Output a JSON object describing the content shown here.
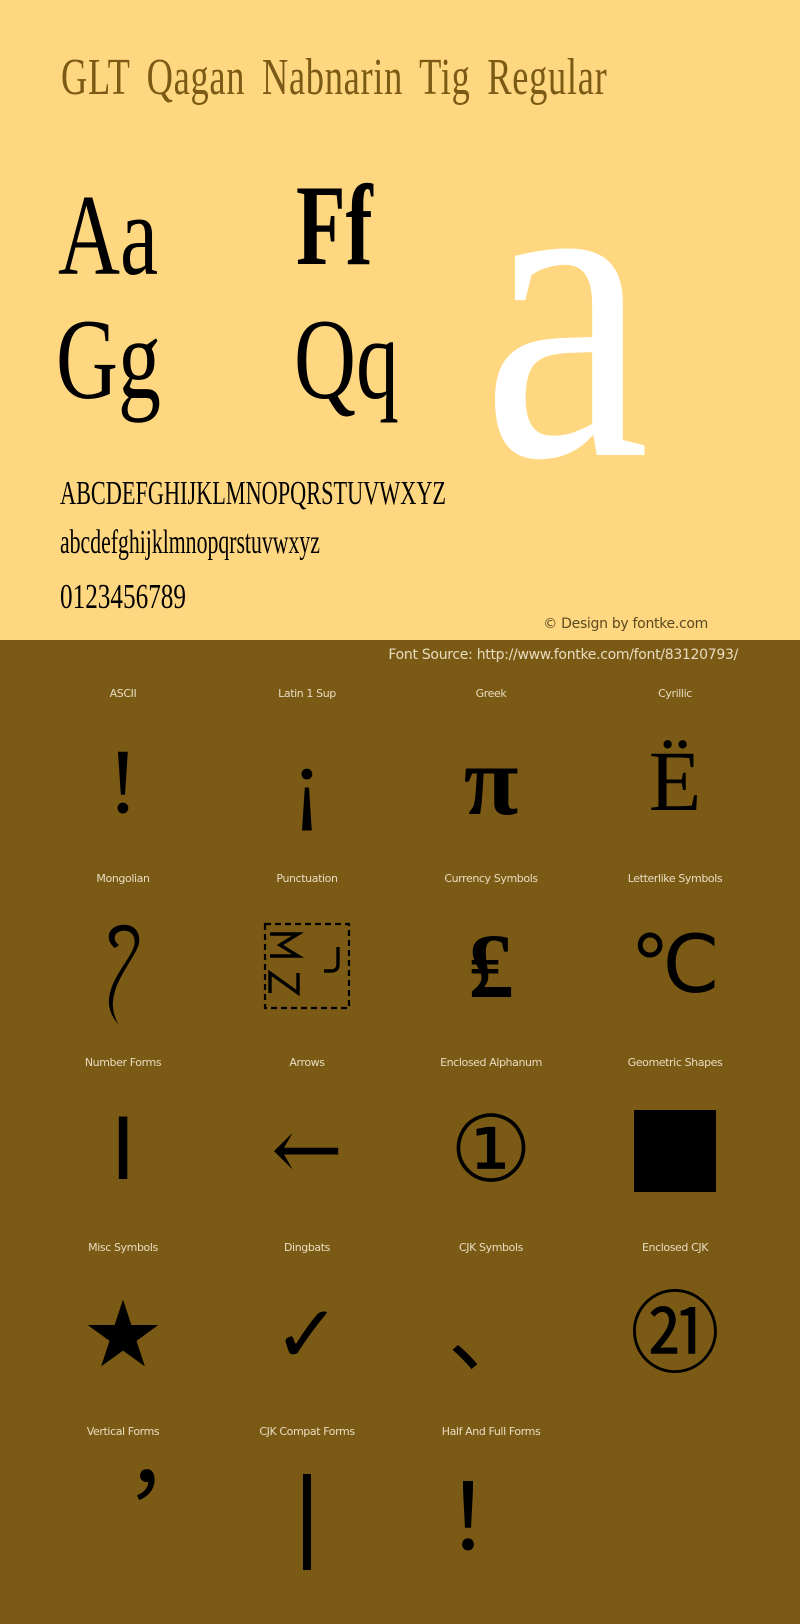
{
  "header": {
    "title": "GLT Qagan Nabnarin Tig Regular"
  },
  "samples": {
    "pairs": [
      "Aa",
      "Ff",
      "Gg",
      "Qq"
    ],
    "big_letter": "a",
    "uppercase": "ABCDEFGHIJKLMNOPQRSTUVWXYZ",
    "lowercase": "abcdefghijklmnopqrstuvwxyz",
    "digits": "0123456789"
  },
  "footer": {
    "copyright": "© Design by fontke.com",
    "source": "Font Source: http://www.fontke.com/font/83120793/"
  },
  "colors": {
    "top_background": "#FFD780",
    "bottom_background": "#7A5A14",
    "title": "#7A5A14",
    "big_letter": "#FFFFFF",
    "glyph": "#000000",
    "label": "#E8DCC0"
  },
  "grid": [
    {
      "label": "ASCII",
      "glyph": "!",
      "icon": "exclamation-glyph"
    },
    {
      "label": "Latin 1 Sup",
      "glyph": "¡",
      "icon": "inverted-exclamation-glyph"
    },
    {
      "label": "Greek",
      "glyph": "π",
      "icon": "pi-glyph"
    },
    {
      "label": "Cyrillic",
      "glyph": "Ё",
      "icon": "cyrillic-yo-glyph"
    },
    {
      "label": "Mongolian",
      "glyph": "",
      "icon": "mongolian-glyph"
    },
    {
      "label": "Punctuation",
      "glyph": "ZWJ",
      "icon": "zwj-placeholder-box"
    },
    {
      "label": "Currency Symbols",
      "glyph": "₤",
      "icon": "lira-glyph"
    },
    {
      "label": "Letterlike Symbols",
      "glyph": "℃",
      "icon": "degree-celsius-glyph"
    },
    {
      "label": "Number Forms",
      "glyph": "Ⅰ",
      "icon": "roman-numeral-one-glyph"
    },
    {
      "label": "Arrows",
      "glyph": "←",
      "icon": "left-arrow-glyph"
    },
    {
      "label": "Enclosed Alphanum",
      "glyph": "①",
      "icon": "circled-one-glyph"
    },
    {
      "label": "Geometric Shapes",
      "glyph": "■",
      "icon": "black-square-glyph"
    },
    {
      "label": "Misc Symbols",
      "glyph": "★",
      "icon": "black-star-glyph"
    },
    {
      "label": "Dingbats",
      "glyph": "✓",
      "icon": "check-mark-glyph"
    },
    {
      "label": "CJK Symbols",
      "glyph": "、",
      "icon": "ideographic-comma-glyph"
    },
    {
      "label": "Enclosed CJK",
      "glyph": "㉑",
      "icon": "circled-twenty-one-glyph"
    },
    {
      "label": "Vertical Forms",
      "glyph": "︐",
      "icon": "vertical-comma-glyph"
    },
    {
      "label": "CJK Compat Forms",
      "glyph": "︱",
      "icon": "vertical-bar-glyph"
    },
    {
      "label": "Half And Full Forms",
      "glyph": "！",
      "icon": "fullwidth-exclamation-glyph"
    }
  ]
}
